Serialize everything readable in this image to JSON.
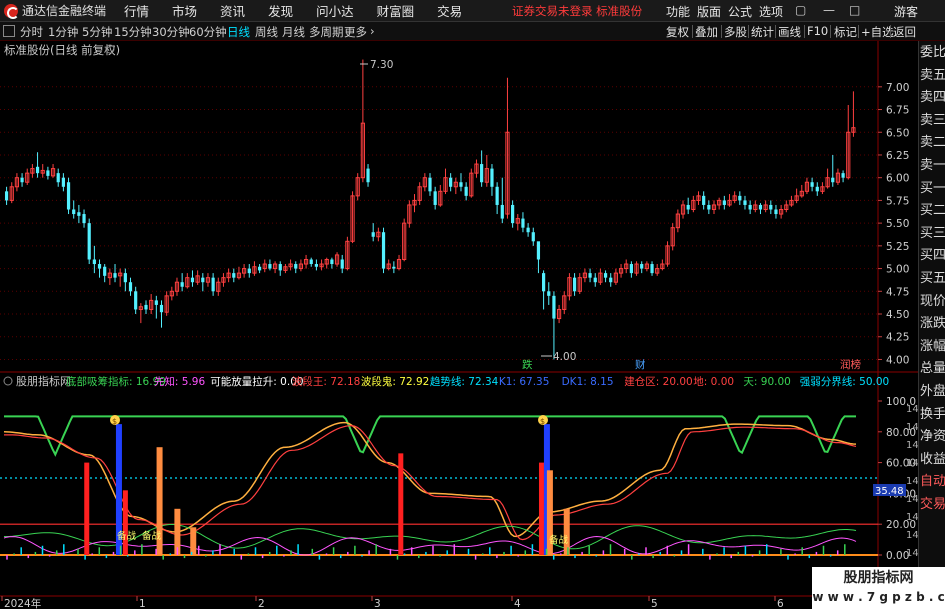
{
  "window": {
    "app_title": "通达信金融终端",
    "menu": [
      "行情",
      "市场",
      "资讯",
      "发现",
      "问小达",
      "财富圈",
      "交易"
    ],
    "notice": "证券交易未登录 标准股份",
    "right_menu": [
      "功能",
      "版面",
      "公式",
      "选项"
    ],
    "user": "游客"
  },
  "toolbar": {
    "periods": [
      "分时",
      "1分钟",
      "5分钟",
      "15分钟",
      "30分钟",
      "60分钟",
      "日线",
      "周线",
      "月线",
      "多周期",
      "更多"
    ],
    "active_period": "日线",
    "right_tools": [
      "复权",
      "叠加",
      "多股",
      "统计",
      "画线",
      "F10",
      "标记",
      "+自选",
      "返回"
    ]
  },
  "price_panel": {
    "title": "标准股份(日线 前复权)",
    "y_ticks": [
      "7.00",
      "6.75",
      "6.50",
      "6.25",
      "6.00",
      "5.75",
      "5.50",
      "5.25",
      "5.00",
      "4.75",
      "4.50",
      "4.25",
      "4.00"
    ],
    "high_marker": "7.30",
    "low_marker": "4.00",
    "badges": [
      {
        "text": "跌",
        "color": "#39d353"
      },
      {
        "text": "财",
        "color": "#4aa3ff"
      },
      {
        "text": "润榜",
        "color": "#ff5b5b"
      }
    ]
  },
  "indicator_panel": {
    "name": "股朋指标网",
    "labels": [
      {
        "text": "底部吸筹指标: 16.99",
        "color": "#39d353"
      },
      {
        "text": "先知: 5.96",
        "color": "#ff55ff"
      },
      {
        "text": "可能放量拉升: 0.00",
        "color": "#ffffff"
      },
      {
        "text": "波段王: 72.18",
        "color": "#ff4040"
      },
      {
        "text": "波段鬼: 72.92",
        "color": "#ffff40"
      },
      {
        "text": "趋势线: 72.34",
        "color": "#00e0ff"
      },
      {
        "text": "K1: 67.35",
        "color": "#3a6bff"
      },
      {
        "text": "DK1: 8.15",
        "color": "#3a6bff"
      },
      {
        "text": "建仓区: 20.00",
        "color": "#ff4040"
      },
      {
        "text": "地: 0.00",
        "color": "#ff4040"
      },
      {
        "text": "天: 90.00",
        "color": "#39d353"
      },
      {
        "text": "强弱分界线: 50.00",
        "color": "#00e0ff"
      }
    ],
    "y_ticks": [
      "100.0",
      "80.00",
      "60.00",
      "40.00",
      "20.00",
      "0.00"
    ],
    "right_strip": [
      "14:56",
      "14:56",
      "14:56",
      "14:56",
      "14:56",
      "14:56",
      "14:56",
      "14:56",
      "14:56",
      "14:56"
    ],
    "current_value": "35.48",
    "text_marks": [
      "备战",
      "备战",
      "备战"
    ],
    "signal_marker": "$"
  },
  "time_axis": {
    "labels": [
      "2024年",
      "1",
      "2",
      "3",
      "4",
      "5",
      "6"
    ]
  },
  "side_panel": {
    "items": [
      "委比",
      "卖五",
      "卖四",
      "卖三",
      "卖二",
      "卖一",
      "买一",
      "买二",
      "买三",
      "买四",
      "买五",
      "现价",
      "涨跌",
      "涨幅",
      "总量",
      "外盘",
      "换手",
      "净资",
      "收益",
      "自动",
      "交易"
    ]
  },
  "watermark": {
    "line1": "股朋指标网",
    "line2": "w w w . 7 g p z b . c o m"
  },
  "colors": {
    "up": "#ff4040",
    "down": "#54f0ff",
    "accent": "#ff3b3b",
    "grid": "#7a0000"
  },
  "chart_data": {
    "type": "candlestick",
    "candles": [
      [
        5.85,
        5.75,
        5.9,
        5.7,
        0
      ],
      [
        5.75,
        5.9,
        5.95,
        5.72,
        1
      ],
      [
        5.9,
        6.0,
        6.05,
        5.85,
        1
      ],
      [
        6.0,
        5.95,
        6.05,
        5.9,
        0
      ],
      [
        5.95,
        6.05,
        6.1,
        5.92,
        1
      ],
      [
        6.05,
        6.1,
        6.15,
        6.0,
        1
      ],
      [
        6.12,
        6.05,
        6.28,
        6.0,
        0
      ],
      [
        6.05,
        6.08,
        6.15,
        6.0,
        1
      ],
      [
        6.08,
        6.02,
        6.12,
        5.98,
        0
      ],
      [
        6.02,
        6.1,
        6.15,
        6.0,
        1
      ],
      [
        6.05,
        5.95,
        6.1,
        5.9,
        0
      ],
      [
        6.0,
        5.9,
        6.05,
        5.85,
        0
      ],
      [
        5.95,
        5.65,
        6.0,
        5.6,
        0
      ],
      [
        5.65,
        5.6,
        5.75,
        5.55,
        0
      ],
      [
        5.62,
        5.58,
        5.7,
        5.5,
        0
      ],
      [
        5.6,
        5.5,
        5.65,
        5.45,
        0
      ],
      [
        5.5,
        5.1,
        5.55,
        5.05,
        0
      ],
      [
        5.1,
        5.05,
        5.25,
        4.95,
        0
      ],
      [
        5.05,
        5.0,
        5.1,
        4.9,
        0
      ],
      [
        5.02,
        4.92,
        5.05,
        4.85,
        0
      ],
      [
        4.9,
        4.95,
        5.0,
        4.82,
        1
      ],
      [
        4.95,
        4.9,
        5.05,
        4.85,
        0
      ],
      [
        4.92,
        4.95,
        5.0,
        4.8,
        1
      ],
      [
        4.95,
        4.85,
        5.0,
        4.75,
        0
      ],
      [
        4.85,
        4.75,
        4.9,
        4.7,
        0
      ],
      [
        4.75,
        4.55,
        4.8,
        4.5,
        0
      ],
      [
        4.55,
        4.58,
        4.62,
        4.4,
        1
      ],
      [
        4.6,
        4.55,
        4.65,
        4.5,
        0
      ],
      [
        4.55,
        4.65,
        4.72,
        4.5,
        1
      ],
      [
        4.65,
        4.6,
        4.7,
        4.45,
        0
      ],
      [
        4.6,
        4.52,
        4.65,
        4.35,
        0
      ],
      [
        4.52,
        4.7,
        4.75,
        4.48,
        1
      ],
      [
        4.7,
        4.75,
        4.8,
        4.65,
        1
      ],
      [
        4.75,
        4.85,
        4.9,
        4.7,
        1
      ],
      [
        4.85,
        4.8,
        4.95,
        4.75,
        0
      ],
      [
        4.8,
        4.9,
        4.95,
        4.78,
        1
      ],
      [
        4.9,
        4.85,
        4.98,
        4.8,
        0
      ],
      [
        4.85,
        4.92,
        4.98,
        4.82,
        1
      ],
      [
        4.9,
        4.85,
        4.95,
        4.75,
        0
      ],
      [
        4.85,
        4.9,
        4.95,
        4.8,
        1
      ],
      [
        4.9,
        4.75,
        4.95,
        4.7,
        0
      ],
      [
        4.75,
        4.85,
        4.9,
        4.7,
        1
      ],
      [
        4.85,
        4.9,
        4.95,
        4.8,
        1
      ],
      [
        4.9,
        4.95,
        5.0,
        4.85,
        1
      ],
      [
        4.95,
        4.9,
        5.0,
        4.85,
        0
      ],
      [
        4.9,
        4.95,
        5.02,
        4.88,
        1
      ],
      [
        4.95,
        5.0,
        5.05,
        4.9,
        1
      ],
      [
        5.0,
        4.95,
        5.05,
        4.9,
        0
      ],
      [
        4.95,
        5.02,
        5.08,
        4.92,
        1
      ],
      [
        5.02,
        4.98,
        5.05,
        4.95,
        0
      ],
      [
        5.0,
        5.05,
        5.1,
        4.96,
        1
      ],
      [
        5.05,
        5.0,
        5.1,
        4.98,
        0
      ],
      [
        5.0,
        5.05,
        5.08,
        4.95,
        1
      ],
      [
        5.05,
        4.98,
        5.08,
        4.92,
        0
      ],
      [
        4.98,
        5.02,
        5.05,
        4.95,
        1
      ],
      [
        5.02,
        5.05,
        5.1,
        4.98,
        1
      ],
      [
        5.05,
        5.0,
        5.08,
        4.95,
        0
      ],
      [
        5.0,
        5.05,
        5.1,
        4.97,
        1
      ],
      [
        5.05,
        5.1,
        5.15,
        5.0,
        1
      ],
      [
        5.1,
        5.05,
        5.12,
        5.02,
        0
      ],
      [
        5.05,
        5.02,
        5.1,
        4.98,
        0
      ],
      [
        5.02,
        5.05,
        5.1,
        4.98,
        1
      ],
      [
        5.05,
        5.1,
        5.12,
        5.0,
        1
      ],
      [
        5.1,
        5.05,
        5.12,
        5.0,
        0
      ],
      [
        5.05,
        5.15,
        5.18,
        5.02,
        1
      ],
      [
        5.1,
        5.0,
        5.15,
        4.95,
        0
      ],
      [
        5.0,
        5.3,
        5.35,
        4.98,
        1
      ],
      [
        5.3,
        5.8,
        5.85,
        5.28,
        1
      ],
      [
        5.8,
        6.0,
        6.05,
        5.75,
        1
      ],
      [
        6.0,
        6.6,
        7.3,
        5.95,
        1
      ],
      [
        6.1,
        5.95,
        6.15,
        5.9,
        0
      ],
      [
        5.4,
        5.35,
        5.5,
        5.3,
        0
      ],
      [
        5.35,
        5.4,
        5.45,
        5.3,
        1
      ],
      [
        5.4,
        5.0,
        5.45,
        4.95,
        0
      ],
      [
        5.0,
        5.05,
        5.1,
        4.98,
        1
      ],
      [
        5.02,
        5.0,
        5.08,
        4.95,
        0
      ],
      [
        5.0,
        5.1,
        5.15,
        4.98,
        1
      ],
      [
        5.1,
        5.5,
        5.55,
        5.08,
        1
      ],
      [
        5.5,
        5.7,
        5.75,
        5.45,
        1
      ],
      [
        5.7,
        5.75,
        5.82,
        5.62,
        1
      ],
      [
        5.75,
        5.9,
        5.95,
        5.7,
        1
      ],
      [
        5.9,
        6.0,
        6.05,
        5.85,
        1
      ],
      [
        6.0,
        5.85,
        6.05,
        5.8,
        0
      ],
      [
        5.85,
        5.7,
        5.9,
        5.65,
        0
      ],
      [
        5.7,
        5.85,
        5.92,
        5.68,
        1
      ],
      [
        5.85,
        6.0,
        6.1,
        5.82,
        1
      ],
      [
        6.0,
        5.9,
        6.05,
        5.85,
        0
      ],
      [
        5.9,
        5.95,
        6.0,
        5.82,
        1
      ],
      [
        5.95,
        5.9,
        6.05,
        5.85,
        0
      ],
      [
        5.9,
        5.8,
        5.95,
        5.75,
        0
      ],
      [
        5.8,
        6.05,
        6.1,
        5.78,
        1
      ],
      [
        6.05,
        6.15,
        6.2,
        6.0,
        1
      ],
      [
        6.15,
        5.95,
        6.3,
        5.9,
        0
      ],
      [
        5.95,
        6.1,
        6.25,
        5.9,
        1
      ],
      [
        6.1,
        5.9,
        6.15,
        5.8,
        0
      ],
      [
        5.9,
        5.7,
        5.95,
        5.6,
        0
      ],
      [
        5.7,
        5.55,
        6.0,
        5.5,
        0
      ],
      [
        5.6,
        6.5,
        7.1,
        5.55,
        1
      ],
      [
        5.7,
        5.5,
        5.75,
        5.45,
        0
      ],
      [
        5.5,
        5.55,
        5.6,
        5.42,
        1
      ],
      [
        5.55,
        5.45,
        5.62,
        5.4,
        0
      ],
      [
        5.45,
        5.4,
        5.5,
        5.35,
        0
      ],
      [
        5.4,
        5.3,
        5.45,
        5.25,
        0
      ],
      [
        5.3,
        5.1,
        5.2,
        4.95,
        0
      ],
      [
        4.95,
        4.75,
        4.98,
        4.55,
        0
      ],
      [
        4.75,
        4.7,
        4.85,
        4.6,
        0
      ],
      [
        4.7,
        4.45,
        4.75,
        4.0,
        0
      ],
      [
        4.45,
        4.55,
        4.6,
        4.4,
        1
      ],
      [
        4.55,
        4.7,
        4.75,
        4.5,
        1
      ],
      [
        4.7,
        4.9,
        4.95,
        4.65,
        1
      ],
      [
        4.9,
        4.75,
        4.95,
        4.7,
        0
      ],
      [
        4.75,
        4.9,
        4.95,
        4.72,
        1
      ],
      [
        4.9,
        4.95,
        5.0,
        4.85,
        1
      ],
      [
        4.95,
        4.9,
        5.0,
        4.85,
        0
      ],
      [
        4.9,
        4.85,
        4.95,
        4.8,
        0
      ],
      [
        4.85,
        4.95,
        5.0,
        4.82,
        1
      ],
      [
        4.95,
        4.9,
        4.98,
        4.85,
        0
      ],
      [
        4.9,
        4.85,
        4.95,
        4.8,
        0
      ],
      [
        4.85,
        4.95,
        5.0,
        4.82,
        1
      ],
      [
        4.95,
        5.0,
        5.05,
        4.9,
        1
      ],
      [
        5.0,
        5.05,
        5.1,
        4.95,
        1
      ],
      [
        5.05,
        4.95,
        5.08,
        4.9,
        0
      ],
      [
        4.95,
        5.05,
        5.08,
        4.92,
        1
      ],
      [
        5.05,
        5.0,
        5.08,
        4.95,
        0
      ],
      [
        5.0,
        5.05,
        5.08,
        4.97,
        1
      ],
      [
        5.05,
        4.95,
        5.08,
        4.92,
        0
      ],
      [
        4.95,
        5.0,
        5.05,
        4.92,
        1
      ],
      [
        5.0,
        5.05,
        5.1,
        4.98,
        1
      ],
      [
        5.05,
        5.25,
        5.3,
        5.02,
        1
      ],
      [
        5.25,
        5.45,
        5.5,
        5.2,
        1
      ],
      [
        5.45,
        5.6,
        5.65,
        5.4,
        1
      ],
      [
        5.6,
        5.7,
        5.75,
        5.55,
        1
      ],
      [
        5.7,
        5.65,
        5.78,
        5.6,
        0
      ],
      [
        5.65,
        5.75,
        5.8,
        5.62,
        1
      ],
      [
        5.75,
        5.8,
        5.85,
        5.7,
        1
      ],
      [
        5.8,
        5.7,
        5.85,
        5.65,
        0
      ],
      [
        5.7,
        5.65,
        5.75,
        5.6,
        0
      ],
      [
        5.65,
        5.7,
        5.75,
        5.6,
        1
      ],
      [
        5.7,
        5.75,
        5.78,
        5.65,
        1
      ],
      [
        5.75,
        5.7,
        5.8,
        5.65,
        0
      ],
      [
        5.7,
        5.75,
        5.82,
        5.68,
        1
      ],
      [
        5.75,
        5.8,
        5.85,
        5.72,
        1
      ],
      [
        5.8,
        5.75,
        5.85,
        5.7,
        0
      ],
      [
        5.75,
        5.7,
        5.8,
        5.65,
        0
      ],
      [
        5.7,
        5.65,
        5.75,
        5.6,
        0
      ],
      [
        5.65,
        5.7,
        5.75,
        5.62,
        1
      ],
      [
        5.7,
        5.65,
        5.72,
        5.6,
        0
      ],
      [
        5.65,
        5.7,
        5.75,
        5.62,
        1
      ],
      [
        5.7,
        5.65,
        5.75,
        5.6,
        0
      ],
      [
        5.65,
        5.6,
        5.7,
        5.55,
        0
      ],
      [
        5.6,
        5.65,
        5.7,
        5.55,
        1
      ],
      [
        5.65,
        5.7,
        5.75,
        5.62,
        1
      ],
      [
        5.7,
        5.75,
        5.8,
        5.68,
        1
      ],
      [
        5.75,
        5.8,
        5.88,
        5.72,
        1
      ],
      [
        5.8,
        5.85,
        5.92,
        5.78,
        1
      ],
      [
        5.85,
        5.95,
        6.0,
        5.82,
        1
      ],
      [
        5.95,
        5.9,
        6.0,
        5.85,
        0
      ],
      [
        5.9,
        5.85,
        5.95,
        5.8,
        0
      ],
      [
        5.85,
        5.9,
        5.95,
        5.82,
        1
      ],
      [
        5.9,
        6.0,
        6.1,
        5.88,
        1
      ],
      [
        6.0,
        5.95,
        6.25,
        5.9,
        0
      ],
      [
        5.95,
        6.05,
        6.1,
        5.92,
        1
      ],
      [
        6.05,
        6.0,
        6.08,
        5.95,
        0
      ],
      [
        6.0,
        6.5,
        6.8,
        5.98,
        1
      ],
      [
        6.5,
        6.55,
        6.95,
        6.45,
        1
      ]
    ],
    "ylim": [
      3.95,
      7.35
    ],
    "indicator": {
      "ylim": [
        0,
        100
      ],
      "reference_lines": [
        90,
        50,
        20,
        0
      ],
      "red_bars": [
        [
          81,
          0,
          60
        ],
        [
          120,
          0,
          42
        ],
        [
          398,
          0,
          66
        ],
        [
          540,
          0,
          60
        ]
      ],
      "blue_bars": [
        [
          113,
          0,
          85
        ],
        [
          545,
          0,
          85
        ]
      ],
      "orange_bars": [
        [
          154,
          0,
          70
        ],
        [
          172,
          0,
          30
        ],
        [
          188,
          0,
          18
        ],
        [
          548,
          0,
          55
        ],
        [
          565,
          0,
          30
        ]
      ]
    }
  }
}
